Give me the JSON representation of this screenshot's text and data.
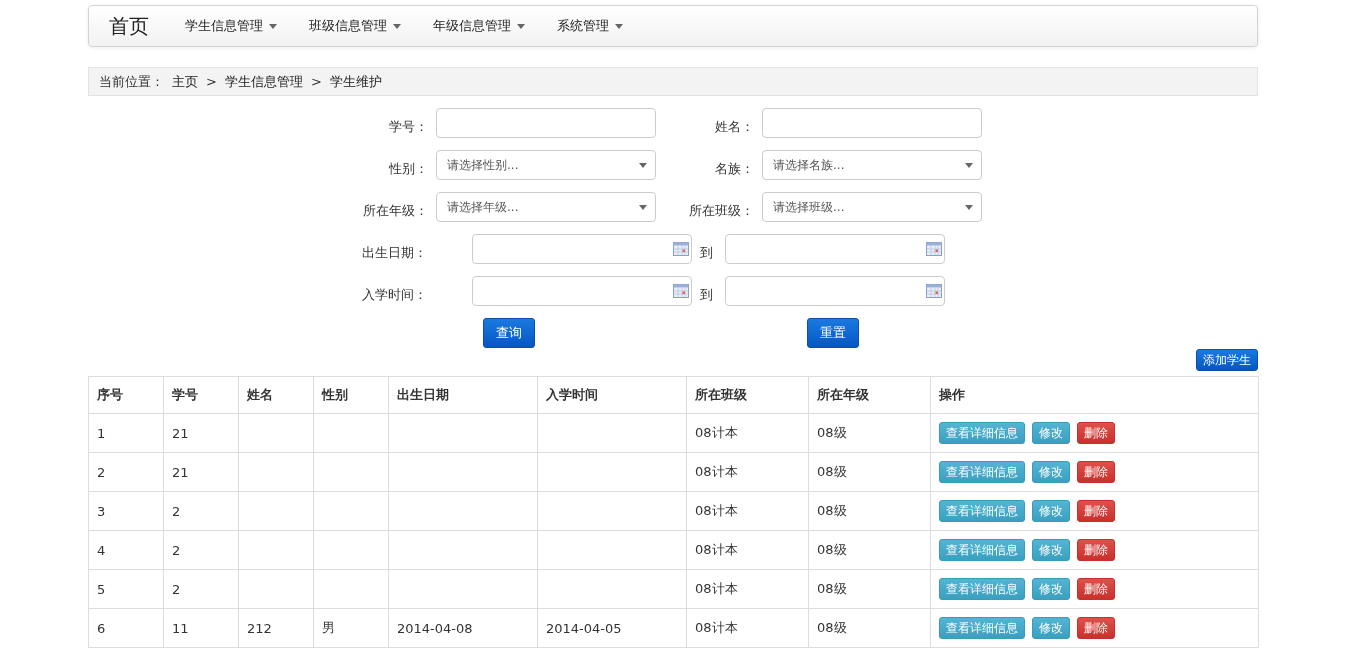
{
  "navbar": {
    "brand": "首页",
    "menus": [
      {
        "label": "学生信息管理"
      },
      {
        "label": "班级信息管理"
      },
      {
        "label": "年级信息管理"
      },
      {
        "label": "系统管理"
      }
    ]
  },
  "breadcrumb": {
    "prefix": "当前位置：",
    "items": [
      "主页",
      "学生信息管理",
      "学生维护"
    ],
    "separator": ">"
  },
  "search_form": {
    "rows": [
      {
        "kind": "inputs",
        "fields": [
          {
            "label": "学号：",
            "kind": "text"
          },
          {
            "label": "姓名：",
            "kind": "text"
          }
        ]
      },
      {
        "kind": "inputs",
        "fields": [
          {
            "label": "性别：",
            "kind": "select",
            "placeholder": "请选择性别..."
          },
          {
            "label": "名族：",
            "kind": "select",
            "placeholder": "请选择名族..."
          }
        ]
      },
      {
        "kind": "inputs",
        "fields": [
          {
            "label": "所在年级：",
            "kind": "select",
            "placeholder": "请选择年级..."
          },
          {
            "label": "所在班级：",
            "kind": "select",
            "placeholder": "请选择班级..."
          }
        ]
      },
      {
        "kind": "range",
        "label": "出生日期：",
        "to": "到"
      },
      {
        "kind": "range",
        "label": "入学时间：",
        "to": "到"
      }
    ],
    "buttons": [
      "查询",
      "重置"
    ]
  },
  "add_button": "添加学生",
  "table": {
    "columns": [
      "序号",
      "学号",
      "姓名",
      "性别",
      "出生日期",
      "入学时间",
      "所在班级",
      "所在年级",
      "操作"
    ],
    "rows": [
      {
        "cells": [
          "1",
          "21",
          "",
          "",
          "",
          "",
          "08计本",
          "08级"
        ],
        "actions": [
          {
            "kind": "view",
            "label": "查看详细信息"
          },
          {
            "kind": "edit",
            "label": "修改"
          },
          {
            "kind": "delete",
            "label": "删除"
          }
        ]
      },
      {
        "cells": [
          "2",
          "21",
          "",
          "",
          "",
          "",
          "08计本",
          "08级"
        ],
        "actions": [
          {
            "kind": "view",
            "label": "查看详细信息"
          },
          {
            "kind": "edit",
            "label": "修改"
          },
          {
            "kind": "delete",
            "label": "删除"
          }
        ]
      },
      {
        "cells": [
          "3",
          "2",
          "",
          "",
          "",
          "",
          "08计本",
          "08级"
        ],
        "actions": [
          {
            "kind": "view",
            "label": "查看详细信息"
          },
          {
            "kind": "edit",
            "label": "修改"
          },
          {
            "kind": "delete",
            "label": "删除"
          }
        ]
      },
      {
        "cells": [
          "4",
          "2",
          "",
          "",
          "",
          "",
          "08计本",
          "08级"
        ],
        "actions": [
          {
            "kind": "view",
            "label": "查看详细信息"
          },
          {
            "kind": "edit",
            "label": "修改"
          },
          {
            "kind": "delete",
            "label": "删除"
          }
        ]
      },
      {
        "cells": [
          "5",
          "2",
          "",
          "",
          "",
          "",
          "08计本",
          "08级"
        ],
        "actions": [
          {
            "kind": "view",
            "label": "查看详细信息"
          },
          {
            "kind": "edit",
            "label": "修改"
          },
          {
            "kind": "delete",
            "label": "删除"
          }
        ]
      },
      {
        "cells": [
          "6",
          "11",
          "212",
          "男",
          "2014-04-08",
          "2014-04-05",
          "08计本",
          "08级"
        ],
        "actions": [
          {
            "kind": "view",
            "label": "查看详细信息"
          },
          {
            "kind": "edit",
            "label": "修改"
          },
          {
            "kind": "delete",
            "label": "删除"
          }
        ]
      }
    ]
  }
}
